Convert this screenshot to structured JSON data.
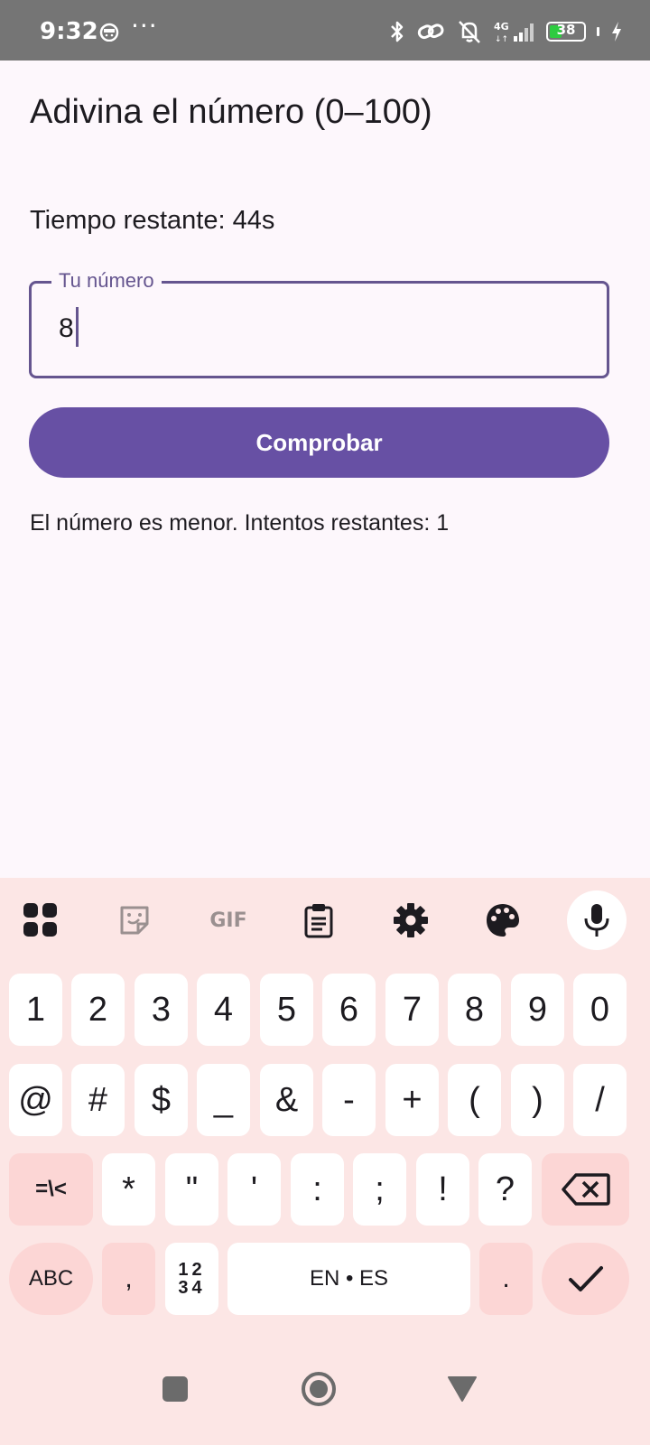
{
  "status_bar": {
    "time": "9:32",
    "dots": "···",
    "battery_level": "38",
    "network": "4G"
  },
  "app": {
    "title": "Adivina el número (0–100)",
    "timer_text": "Tiempo restante: 44s",
    "input": {
      "label": "Tu número",
      "value": "8"
    },
    "check_button": "Comprobar",
    "message": "El número es menor. Intentos restantes: 1"
  },
  "keyboard": {
    "toolbar": [
      "apps-grid-icon",
      "sticker-icon",
      "gif-icon",
      "clipboard-icon",
      "settings-gear-icon",
      "palette-icon",
      "microphone-icon"
    ],
    "gif_label": "GIF",
    "row1": [
      "1",
      "2",
      "3",
      "4",
      "5",
      "6",
      "7",
      "8",
      "9",
      "0"
    ],
    "row2": [
      "@",
      "#",
      "$",
      "_",
      "&",
      "-",
      "+",
      "(",
      ")",
      "/"
    ],
    "row3": [
      "=\\<",
      "*",
      "\"",
      "'",
      ":",
      ";",
      "!",
      "?"
    ],
    "row4": {
      "abc": "ABC",
      "comma": ",",
      "numpad_top": "12",
      "numpad_bottom": "34",
      "space": "EN • ES",
      "period": "."
    }
  },
  "colors": {
    "primary": "#6750a4",
    "outline": "#65558f",
    "keyboard_bg": "#fce6e5",
    "key_alt": "#fcd6d5"
  }
}
